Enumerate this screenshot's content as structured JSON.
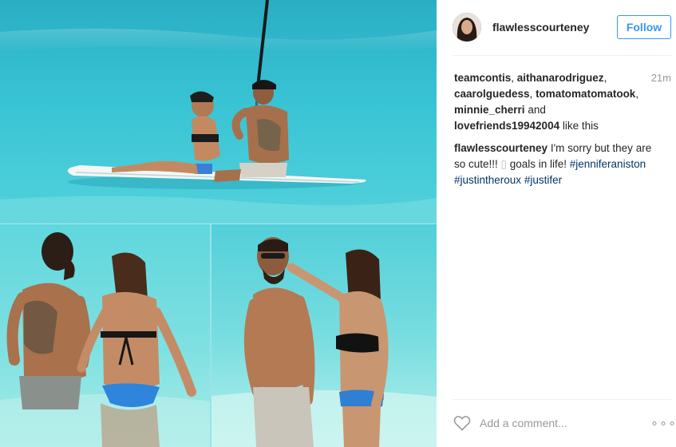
{
  "post": {
    "username": "flawlesscourteney",
    "follow_label": "Follow",
    "time_ago": "21m",
    "likes": {
      "users": [
        "teamcontis",
        "aithanarodriguez",
        "caarolguedess",
        "tomatomatomatook",
        "minnie_cherri"
      ],
      "and_text": "and",
      "last_user": "lovefriends19942004",
      "suffix": "like this"
    },
    "caption": {
      "author": "flawlesscourteney",
      "text_1": "I'm sorry but they are so cute!!! ",
      "emoji": "▯",
      "text_2": " goals in life! ",
      "hashtags": [
        "#jenniferaniston",
        "#justintheroux",
        "#justifer"
      ]
    },
    "comment_placeholder": "Add a comment...",
    "more_label": "∘∘∘"
  },
  "colors": {
    "accent": "#3897f0",
    "hashtag": "#003569",
    "muted": "#999999",
    "water": "#38c3d4"
  },
  "icons": {
    "heart": "heart-outline-icon",
    "more": "more-options-icon"
  }
}
